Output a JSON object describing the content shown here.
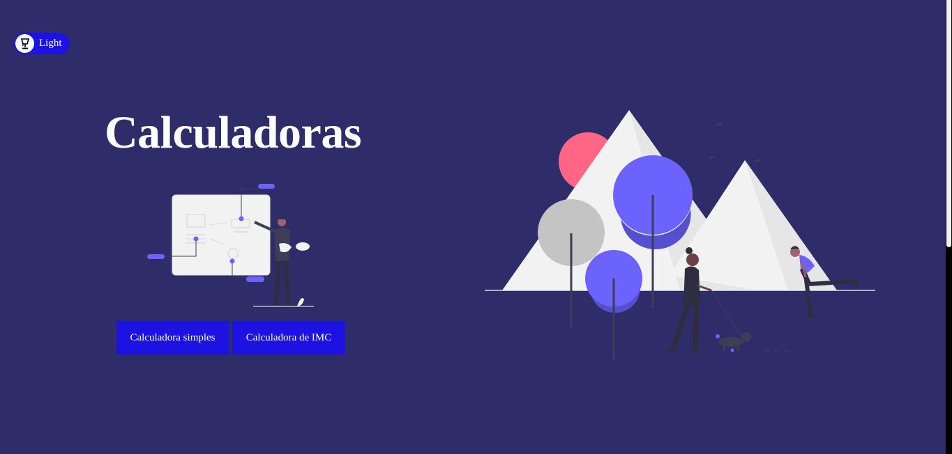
{
  "theme_toggle": {
    "label": "Light",
    "icon": "lamp-icon"
  },
  "hero": {
    "title": "Calculadoras"
  },
  "buttons": {
    "simple": "Calculadora simples",
    "imc": "Calculadora de IMC"
  },
  "colors": {
    "background": "#2f2c6a",
    "button": "#1c13e2",
    "accent_purple": "#6c63ff",
    "accent_pink": "#ff6584"
  }
}
